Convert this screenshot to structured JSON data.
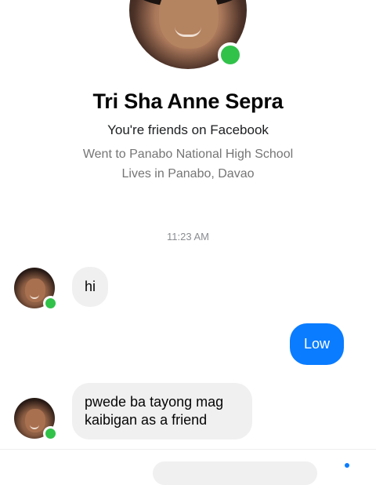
{
  "profile": {
    "name": "Tri Sha Anne Sepra",
    "relationship": "You're friends on Facebook",
    "education": "Went to Panabo National High School",
    "location": "Lives in Panabo, Davao",
    "online": true
  },
  "conversation": {
    "timestamp": "11:23 AM",
    "messages": [
      {
        "sender": "contact",
        "text": "hi"
      },
      {
        "sender": "me",
        "text": "Low"
      },
      {
        "sender": "contact",
        "text": "pwede ba tayong mag kaibigan  as a friend"
      }
    ]
  },
  "colors": {
    "accent": "#0a7cff",
    "online": "#31c24a",
    "incoming_bubble": "#f0f0f0"
  }
}
